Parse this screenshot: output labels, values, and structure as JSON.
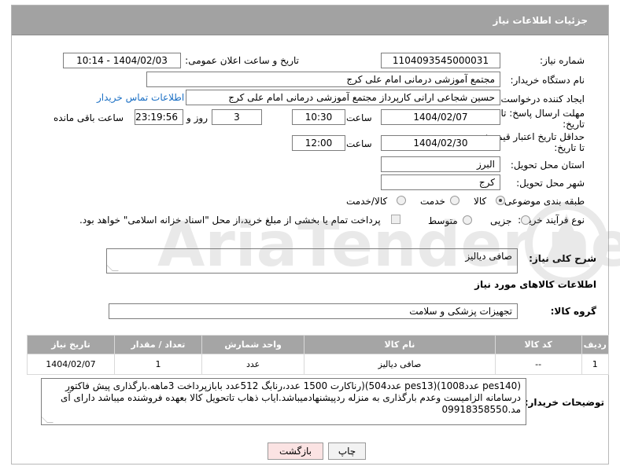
{
  "header": {
    "title": "جزئیات اطلاعات نیاز"
  },
  "fields": {
    "need_number_label": "شماره نیاز:",
    "need_number": "1104093545000031",
    "announce_label": "تاریخ و ساعت اعلان عمومی:",
    "announce_value": "1404/02/03 - 10:14",
    "buyer_label": "نام دستگاه خریدار:",
    "buyer_value": "مجتمع آموزشی درمانی امام علی کرج",
    "creator_label": "ایجاد کننده درخواست:",
    "creator_value": "حسین شجاعی ارانی کارپرداز مجتمع آموزشی درمانی امام علی کرج",
    "contact_link": "اطلاعات تماس خریدار",
    "deadline_label_1": "مهلت ارسال پاسخ: تا",
    "deadline_label_2": "تاریخ:",
    "deadline_date": "1404/02/07",
    "hour_label": "ساعت",
    "deadline_time": "10:30",
    "days_value": "3",
    "days_label": "روز و",
    "remaining_time": "23:19:56",
    "remaining_label": "ساعت باقی مانده",
    "validity_label_1": "حداقل تاریخ اعتبار قیمت:",
    "validity_label_2": "تا تاریخ:",
    "validity_date": "1404/02/30",
    "validity_hour_label": "ساعت",
    "validity_time": "12:00",
    "province_label": "استان محل تحویل:",
    "province_value": "البرز",
    "city_label": "شهر محل تحویل:",
    "city_value": "کرج",
    "category_label": "طبقه بندی موضوعی:",
    "category_options": [
      "کالا",
      "خدمت",
      "کالا/خدمت"
    ],
    "process_label": "نوع فرآیند خرید :",
    "process_options": [
      "جزیی",
      "متوسط"
    ],
    "payment_note": "پرداخت تمام یا بخشی از مبلغ خرید،از محل \"اسناد خزانه اسلامی\" خواهد بود."
  },
  "description": {
    "label": "شرح کلی نیاز:",
    "value": "صافی دیالیز"
  },
  "goods": {
    "section_title": "اطلاعات کالاهای مورد نیاز",
    "group_label": "گروه کالا:",
    "group_value": "تجهیزات پزشکی و سلامت",
    "columns": [
      "ردیف",
      "کد کالا",
      "نام کالا",
      "واحد شمارش",
      "تعداد / مقدار",
      "تاریخ نیاز"
    ],
    "rows": [
      [
        "1",
        "--",
        "صافی دیالیز",
        "عدد",
        "1",
        "1404/02/07"
      ]
    ]
  },
  "buyer_notes": {
    "label": "توضیحات خریدار:",
    "value": "(pes140 عدد1008)(pes13 عدد504)(رناکارت 1500 عدد،رنابگ 512عدد بابازپرداخت 3ماهه.بارگذاری پیش فاکتور درسامانه الزامیست وعدم بارگذاری به منزله ردپیشنهادمیباشد.ایاب ذهاب تاتحویل کالا بعهده فروشنده میباشد دارای آی مد.09918358550"
  },
  "buttons": {
    "print": "چاپ",
    "back": "بازگشت"
  },
  "watermark": {
    "text": "AriaTender.net"
  },
  "colors": {
    "header_bg": "#a2a2a2",
    "table_header_bg": "#a5a5a5",
    "link": "#1a6fc4",
    "back_button_bg": "#fbe3e3"
  }
}
